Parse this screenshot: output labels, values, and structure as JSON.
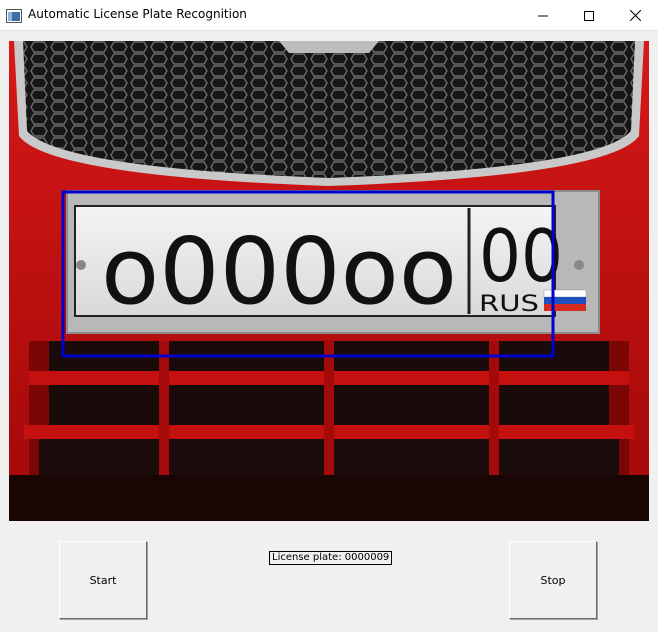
{
  "window": {
    "title": "Automatic License Plate Recognition",
    "icon": "app-window-icon",
    "controls": [
      "minimize-icon",
      "maximize-icon",
      "close-icon"
    ]
  },
  "video": {
    "plate": {
      "main_text": "o000oo",
      "region": "00",
      "country": "RUS"
    },
    "detection_box_color": "#0000cc"
  },
  "controls": {
    "start_label": "Start",
    "stop_label": "Stop",
    "status_text": "License plate: 0000009"
  }
}
